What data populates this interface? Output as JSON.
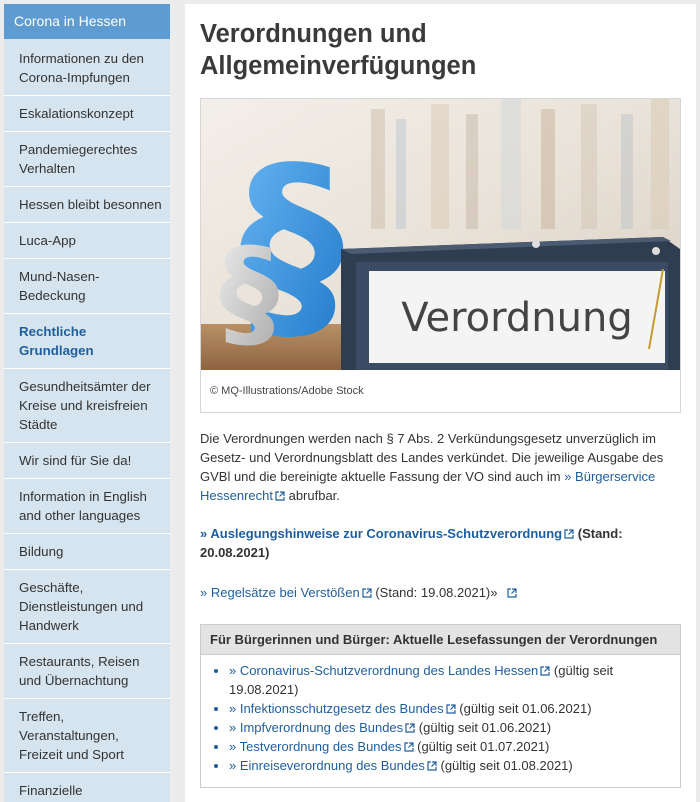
{
  "sidebar": {
    "title": "Corona in Hessen",
    "items": [
      {
        "label": "Informationen zu den Corona-Impfungen",
        "active": false
      },
      {
        "label": "Eskalationskonzept",
        "active": false
      },
      {
        "label": "Pandemiegerechtes Verhalten",
        "active": false
      },
      {
        "label": "Hessen bleibt besonnen",
        "active": false
      },
      {
        "label": "Luca-App",
        "active": false
      },
      {
        "label": "Mund-Nasen-Bedeckung",
        "active": false
      },
      {
        "label": "Rechtliche Grundlagen",
        "active": true
      },
      {
        "label": "Gesundheitsämter der Kreise und kreisfreien Städte",
        "active": false
      },
      {
        "label": "Wir sind für Sie da!",
        "active": false
      },
      {
        "label": "Information in English and other languages",
        "active": false
      },
      {
        "label": "Bildung",
        "active": false
      },
      {
        "label": "Geschäfte, Dienstleistungen und Handwerk",
        "active": false
      },
      {
        "label": "Restaurants, Reisen und Übernachtung",
        "active": false
      },
      {
        "label": "Treffen, Veranstaltungen, Freizeit und Sport",
        "active": false
      },
      {
        "label": "Finanzielle Unterstützung in der",
        "active": false
      }
    ]
  },
  "main": {
    "title": "Verordnungen und Allgemeinverfügungen",
    "image": {
      "binder_text": "Verordnung",
      "caption": "© MQ-Illustrations/Adobe Stock"
    },
    "intro": {
      "text_before": "Die Verordnungen werden nach § 7 Abs. 2 Verkündungsgesetz unverzüglich im Gesetz- und Verordnungsblatt des Landes verkündet. Die jeweilige Ausgabe des GVBl und die bereinigte aktuelle Fassung der VO sind auch im ",
      "link": "» Bürgerservice Hessenrecht",
      "text_after": " abrufbar."
    },
    "guidance": {
      "link": "» Auslegungshinweise zur Coronavirus-Schutzverordnung",
      "suffix": "(Stand: 20.08.2021)"
    },
    "fines": {
      "link": "» Regelsätze bei Verstößen",
      "suffix": "(Stand: 19.08.2021)»"
    },
    "box": {
      "title": "Für Bürgerinnen und Bürger: Aktuelle Lesefassungen der Verordnungen",
      "items": [
        {
          "link": "» Coronavirus-Schutzverordnung des Landes Hessen",
          "note": "(gültig seit 19.08.2021)"
        },
        {
          "link": "» Infektionsschutzgesetz des Bundes",
          "note": "(gültig seit 01.06.2021)"
        },
        {
          "link": "» Impfverordnung des Bundes",
          "note": "(gültig seit 01.06.2021)"
        },
        {
          "link": "» Testverordnung des Bundes",
          "note": "(gültig seit 01.07.2021)"
        },
        {
          "link": "» Einreiseverordnung des Bundes",
          "note": "(gültig seit 01.08.2021)"
        }
      ]
    }
  },
  "colors": {
    "sidebar_header": "#5e9bd1",
    "sidebar_bg": "#d6e4ef",
    "link": "#1f5e9e",
    "binder_blue": "#3a4b63",
    "paragraph_blue": "#2e8fe0"
  }
}
